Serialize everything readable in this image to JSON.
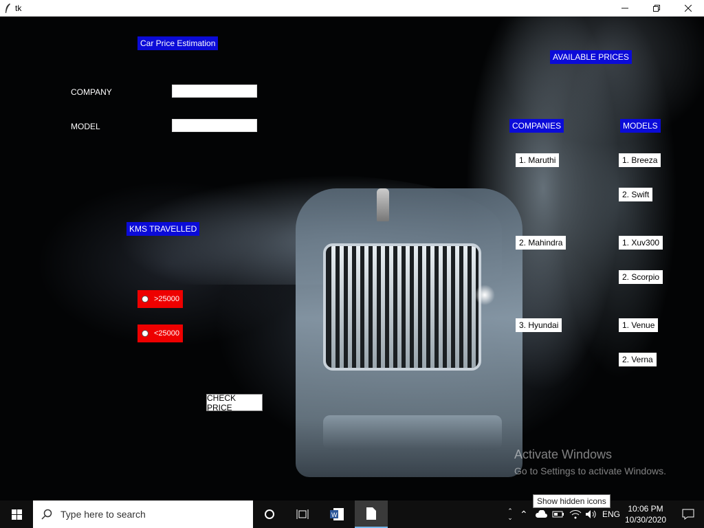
{
  "window": {
    "title": "tk"
  },
  "app": {
    "heading": "Car Price Estimation",
    "company_label": "COMPANY",
    "company_value": "",
    "model_label": "MODEL",
    "model_value": "",
    "kms_label": "KMS TRAVELLED",
    "radio_options": [
      ">25000",
      "<25000"
    ],
    "check_button": "CHECK PRICE",
    "available_prices": "AVAILABLE PRICES",
    "companies_header": "COMPANIES",
    "models_header": "MODELS",
    "companies": [
      "1. Maruthi",
      "2. Mahindra",
      "3. Hyundai"
    ],
    "models": [
      "1. Breeza",
      "2. Swift",
      "1. Xuv300",
      "2. Scorpio",
      "1. Venue",
      "2. Verna"
    ]
  },
  "watermark": {
    "title": "Activate Windows",
    "subtitle": "Go to Settings to activate Windows."
  },
  "taskbar": {
    "search_placeholder": "Type here to search",
    "tooltip": "Show hidden icons",
    "language": "ENG",
    "time": "10:06 PM",
    "date": "10/30/2020"
  },
  "colors": {
    "label_blue": "#0b0bd8",
    "radio_red": "#ee0000",
    "taskbar": "#0f0f0f"
  }
}
